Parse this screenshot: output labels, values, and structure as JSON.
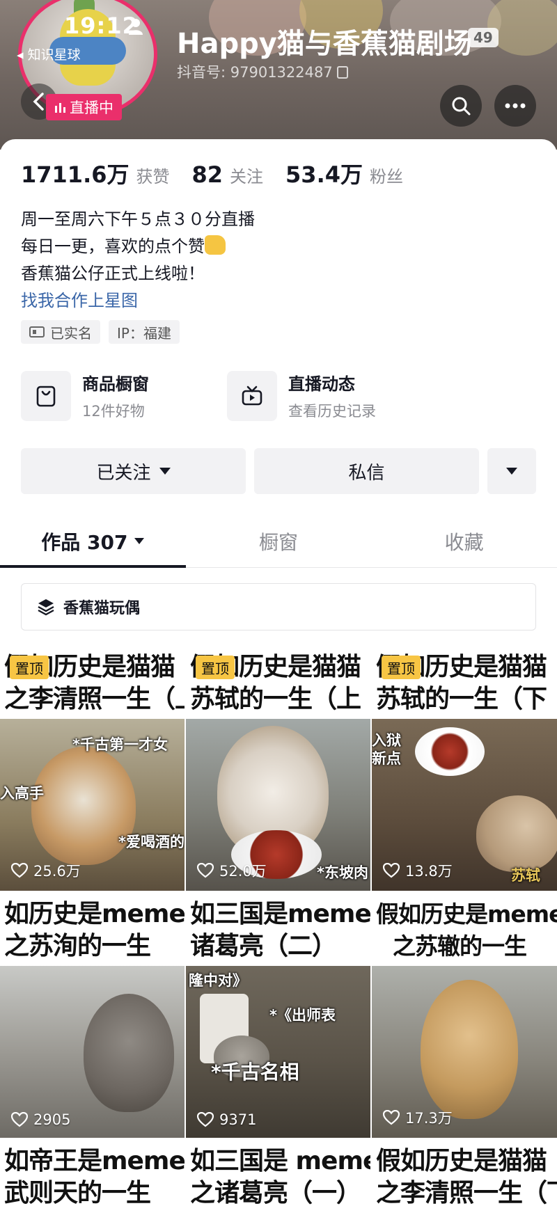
{
  "status_bar": {
    "time": "19:12",
    "back_app": "知识星球"
  },
  "profile": {
    "nickname": "Happy猫与香蕉猫剧场",
    "level": "49",
    "douyin_id": "抖音号: 97901322487",
    "live_badge": "直播中"
  },
  "stats": [
    {
      "num": "1711.6万",
      "label": "获赞"
    },
    {
      "num": "82",
      "label": "关注"
    },
    {
      "num": "53.4万",
      "label": "粉丝"
    }
  ],
  "bio": {
    "line1": "周一至周六下午５点３０分直播",
    "line2": "每日一更，喜欢的点个赞",
    "line3": "香蕉猫公仔正式上线啦！",
    "link": "找我合作上星图"
  },
  "tags": {
    "realname": "已实名",
    "ip": "IP：福建"
  },
  "services": [
    {
      "title": "商品橱窗",
      "sub": "12件好物",
      "icon": "shopping-bag-icon"
    },
    {
      "title": "直播动态",
      "sub": "查看历史记录",
      "icon": "tv-icon"
    }
  ],
  "actions": {
    "follow": "已关注",
    "message": "私信"
  },
  "tabs": {
    "works": "作品 307",
    "window": "橱窗",
    "favorites": "收藏"
  },
  "collection": {
    "label": "香蕉猫玩偶"
  },
  "pin_label": "置顶",
  "videos": [
    {
      "line1": "假如历史是猫猫",
      "line2": "之李清照一生（上",
      "pinned": true,
      "likes": "25.6万",
      "overlay1": "*千古第一才女",
      "overlay2": "入高手",
      "overlay3": "*爱喝酒的"
    },
    {
      "line1": "假如历史是猫猫",
      "line2": "苏轼的一生（上",
      "pinned": true,
      "likes": "52.0万",
      "overlay1": "*东坡肉"
    },
    {
      "line1": "假如历史是猫猫",
      "line2": "苏轼的一生（下",
      "pinned": true,
      "likes": "13.8万",
      "overlay1": "入狱",
      "overlay2": "新点",
      "overlay3": "苏轼"
    },
    {
      "line1": "如历史是meme",
      "line2": "之苏洵的一生",
      "pinned": false,
      "likes": "2905"
    },
    {
      "line1": "如三国是meme",
      "line2": "诸葛亮（二）",
      "pinned": false,
      "likes": "9371",
      "overlay1": "隆中对》",
      "overlay2": "*《出师表",
      "overlay3": "*千古名相"
    },
    {
      "line1": "假如历史是meme",
      "line2": "之苏辙的一生",
      "pinned": false,
      "likes": "17.3万"
    },
    {
      "line1": "如帝王是meme",
      "line2": "武则天的一生",
      "pinned": false
    },
    {
      "line1": "如三国是 meme",
      "line2": "之诸葛亮（一）",
      "pinned": false
    },
    {
      "line1": "假如历史是猫猫",
      "line2": "之李清照一生（下",
      "pinned": false
    }
  ],
  "colors": {
    "accent": "#ea2f6b",
    "link": "#3a66a8",
    "pin": "#f7c544"
  }
}
